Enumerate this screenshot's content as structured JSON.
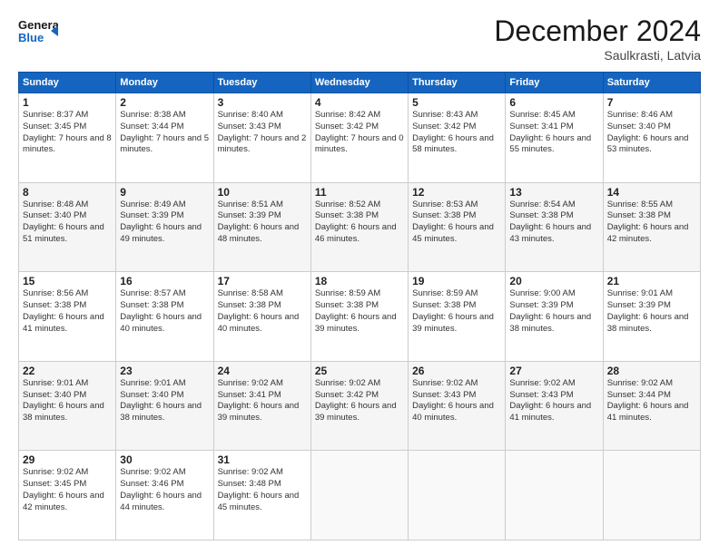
{
  "header": {
    "logo_line1": "General",
    "logo_line2": "Blue",
    "month_title": "December 2024",
    "location": "Saulkrasti, Latvia"
  },
  "days_of_week": [
    "Sunday",
    "Monday",
    "Tuesday",
    "Wednesday",
    "Thursday",
    "Friday",
    "Saturday"
  ],
  "weeks": [
    [
      {
        "day": "1",
        "sunrise": "8:37 AM",
        "sunset": "3:45 PM",
        "daylight": "7 hours and 8 minutes."
      },
      {
        "day": "2",
        "sunrise": "8:38 AM",
        "sunset": "3:44 PM",
        "daylight": "7 hours and 5 minutes."
      },
      {
        "day": "3",
        "sunrise": "8:40 AM",
        "sunset": "3:43 PM",
        "daylight": "7 hours and 2 minutes."
      },
      {
        "day": "4",
        "sunrise": "8:42 AM",
        "sunset": "3:42 PM",
        "daylight": "7 hours and 0 minutes."
      },
      {
        "day": "5",
        "sunrise": "8:43 AM",
        "sunset": "3:42 PM",
        "daylight": "6 hours and 58 minutes."
      },
      {
        "day": "6",
        "sunrise": "8:45 AM",
        "sunset": "3:41 PM",
        "daylight": "6 hours and 55 minutes."
      },
      {
        "day": "7",
        "sunrise": "8:46 AM",
        "sunset": "3:40 PM",
        "daylight": "6 hours and 53 minutes."
      }
    ],
    [
      {
        "day": "8",
        "sunrise": "8:48 AM",
        "sunset": "3:40 PM",
        "daylight": "6 hours and 51 minutes."
      },
      {
        "day": "9",
        "sunrise": "8:49 AM",
        "sunset": "3:39 PM",
        "daylight": "6 hours and 49 minutes."
      },
      {
        "day": "10",
        "sunrise": "8:51 AM",
        "sunset": "3:39 PM",
        "daylight": "6 hours and 48 minutes."
      },
      {
        "day": "11",
        "sunrise": "8:52 AM",
        "sunset": "3:38 PM",
        "daylight": "6 hours and 46 minutes."
      },
      {
        "day": "12",
        "sunrise": "8:53 AM",
        "sunset": "3:38 PM",
        "daylight": "6 hours and 45 minutes."
      },
      {
        "day": "13",
        "sunrise": "8:54 AM",
        "sunset": "3:38 PM",
        "daylight": "6 hours and 43 minutes."
      },
      {
        "day": "14",
        "sunrise": "8:55 AM",
        "sunset": "3:38 PM",
        "daylight": "6 hours and 42 minutes."
      }
    ],
    [
      {
        "day": "15",
        "sunrise": "8:56 AM",
        "sunset": "3:38 PM",
        "daylight": "6 hours and 41 minutes."
      },
      {
        "day": "16",
        "sunrise": "8:57 AM",
        "sunset": "3:38 PM",
        "daylight": "6 hours and 40 minutes."
      },
      {
        "day": "17",
        "sunrise": "8:58 AM",
        "sunset": "3:38 PM",
        "daylight": "6 hours and 40 minutes."
      },
      {
        "day": "18",
        "sunrise": "8:59 AM",
        "sunset": "3:38 PM",
        "daylight": "6 hours and 39 minutes."
      },
      {
        "day": "19",
        "sunrise": "8:59 AM",
        "sunset": "3:38 PM",
        "daylight": "6 hours and 39 minutes."
      },
      {
        "day": "20",
        "sunrise": "9:00 AM",
        "sunset": "3:39 PM",
        "daylight": "6 hours and 38 minutes."
      },
      {
        "day": "21",
        "sunrise": "9:01 AM",
        "sunset": "3:39 PM",
        "daylight": "6 hours and 38 minutes."
      }
    ],
    [
      {
        "day": "22",
        "sunrise": "9:01 AM",
        "sunset": "3:40 PM",
        "daylight": "6 hours and 38 minutes."
      },
      {
        "day": "23",
        "sunrise": "9:01 AM",
        "sunset": "3:40 PM",
        "daylight": "6 hours and 38 minutes."
      },
      {
        "day": "24",
        "sunrise": "9:02 AM",
        "sunset": "3:41 PM",
        "daylight": "6 hours and 39 minutes."
      },
      {
        "day": "25",
        "sunrise": "9:02 AM",
        "sunset": "3:42 PM",
        "daylight": "6 hours and 39 minutes."
      },
      {
        "day": "26",
        "sunrise": "9:02 AM",
        "sunset": "3:43 PM",
        "daylight": "6 hours and 40 minutes."
      },
      {
        "day": "27",
        "sunrise": "9:02 AM",
        "sunset": "3:43 PM",
        "daylight": "6 hours and 41 minutes."
      },
      {
        "day": "28",
        "sunrise": "9:02 AM",
        "sunset": "3:44 PM",
        "daylight": "6 hours and 41 minutes."
      }
    ],
    [
      {
        "day": "29",
        "sunrise": "9:02 AM",
        "sunset": "3:45 PM",
        "daylight": "6 hours and 42 minutes."
      },
      {
        "day": "30",
        "sunrise": "9:02 AM",
        "sunset": "3:46 PM",
        "daylight": "6 hours and 44 minutes."
      },
      {
        "day": "31",
        "sunrise": "9:02 AM",
        "sunset": "3:48 PM",
        "daylight": "6 hours and 45 minutes."
      },
      null,
      null,
      null,
      null
    ]
  ]
}
